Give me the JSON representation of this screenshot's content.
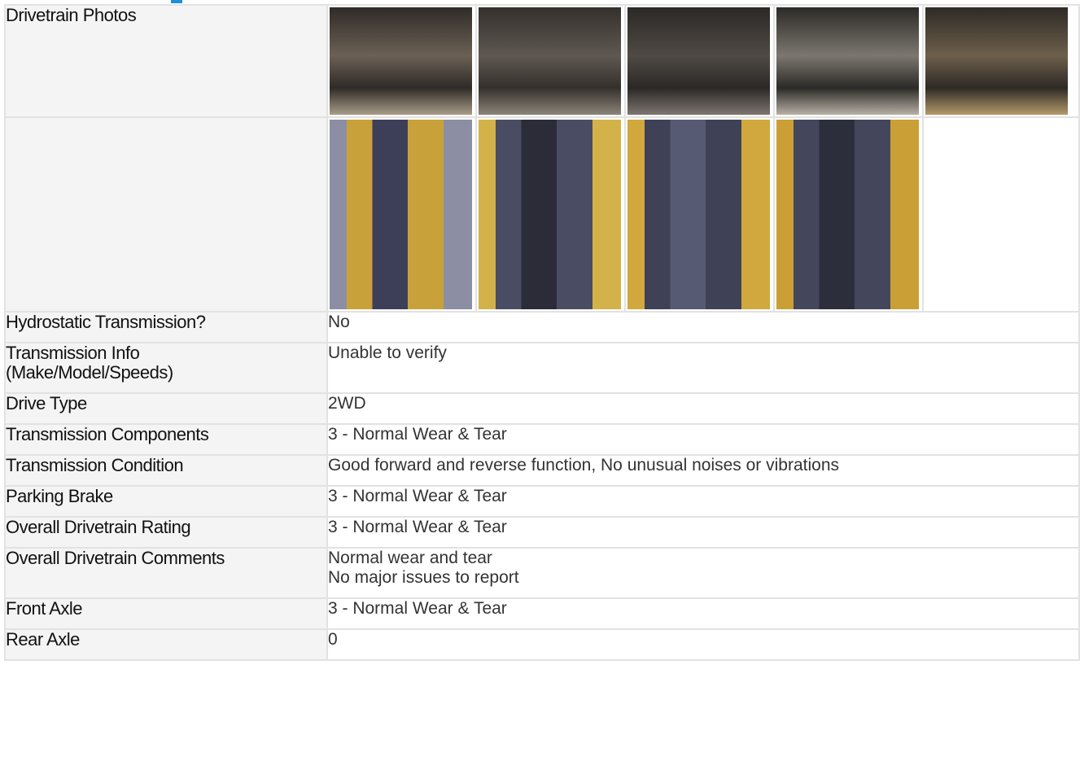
{
  "rows": {
    "photos_label": "Drivetrain Photos",
    "hydrostatic": {
      "label": "Hydrostatic Transmission?",
      "value": "No"
    },
    "trans_info": {
      "label_line1": "Transmission Info",
      "label_line2": "(Make/Model/Speeds)",
      "value": "Unable to verify"
    },
    "drive_type": {
      "label": "Drive Type",
      "value": "2WD"
    },
    "trans_components": {
      "label": "Transmission Components",
      "value": "3 - Normal Wear & Tear"
    },
    "trans_condition": {
      "label": "Transmission Condition",
      "value": "Good forward and reverse function, No unusual noises or vibrations"
    },
    "parking_brake": {
      "label": "Parking Brake",
      "value": "3 - Normal Wear & Tear"
    },
    "overall_rating": {
      "label": "Overall Drivetrain Rating",
      "value": "3 - Normal Wear & Tear"
    },
    "overall_comments": {
      "label": "Overall Drivetrain Comments",
      "line1": "Normal wear and tear",
      "line2": "No major issues to report"
    },
    "front_axle": {
      "label": "Front Axle",
      "value": "3 - Normal Wear & Tear"
    },
    "rear_axle": {
      "label": "Rear Axle",
      "value": "0"
    }
  },
  "photos_row1": [
    {
      "tone": [
        "#6b6155",
        "#2f2b27",
        "#a89c88"
      ]
    },
    {
      "tone": [
        "#5e5851",
        "#34302c",
        "#8c8478"
      ]
    },
    {
      "tone": [
        "#4f4a45",
        "#2b2826",
        "#7d7670"
      ]
    },
    {
      "tone": [
        "#7b776f",
        "#2c2a27",
        "#b7b1a5"
      ]
    },
    {
      "tone": [
        "#6d5f4b",
        "#2e2a25",
        "#b49a6a"
      ]
    }
  ],
  "photos_row2": [
    {
      "tone": [
        "#c9a13a",
        "#3d3f58",
        "#8c8ea3"
      ]
    },
    {
      "tone": [
        "#4a4c63",
        "#2b2c38",
        "#d4b24a"
      ]
    },
    {
      "tone": [
        "#3f4156",
        "#565a73",
        "#d1a83d"
      ]
    },
    {
      "tone": [
        "#44465c",
        "#2d2e3c",
        "#c99f36"
      ]
    }
  ]
}
